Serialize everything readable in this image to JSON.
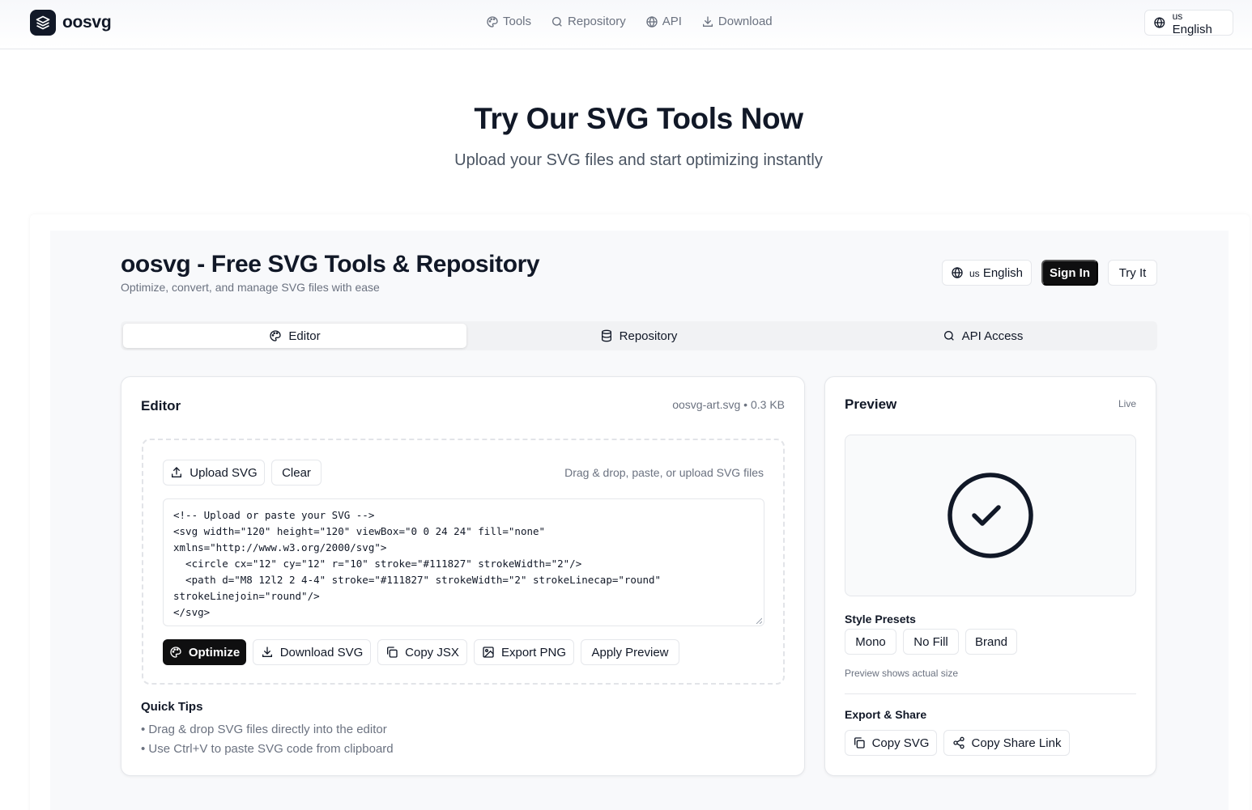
{
  "nav": {
    "brand": "oosvg",
    "links": [
      "Tools",
      "Repository",
      "API",
      "Download"
    ],
    "lang_code": "us",
    "lang_label": "English"
  },
  "hero": {
    "title": "Try Our SVG Tools Now",
    "subtitle": "Upload your SVG files and start optimizing instantly"
  },
  "app": {
    "title": "oosvg - Free SVG Tools & Repository",
    "subtitle": "Optimize, convert, and manage SVG files with ease",
    "lang_code": "us",
    "lang_label": "English",
    "sign_in": "Sign In",
    "try_it": "Try It"
  },
  "tabs": [
    "Editor",
    "Repository",
    "API Access"
  ],
  "editor": {
    "title": "Editor",
    "file_name": "oosvg-art.svg",
    "file_size": "0.3 KB",
    "upload_label": "Upload SVG",
    "clear_label": "Clear",
    "hint": "Drag & drop, paste, or upload SVG files",
    "code": "<!-- Upload or paste your SVG -->\n<svg width=\"120\" height=\"120\" viewBox=\"0 0 24 24\" fill=\"none\"\nxmlns=\"http://www.w3.org/2000/svg\">\n  <circle cx=\"12\" cy=\"12\" r=\"10\" stroke=\"#111827\" strokeWidth=\"2\"/>\n  <path d=\"M8 12l2 2 4-4\" stroke=\"#111827\" strokeWidth=\"2\" strokeLinecap=\"round\"\nstrokeLinejoin=\"round\"/>\n</svg>",
    "actions": [
      "Optimize",
      "Download SVG",
      "Copy JSX",
      "Export PNG",
      "Apply Preview"
    ],
    "tips_title": "Quick Tips",
    "tips": [
      "• Drag & drop SVG files directly into the editor",
      "• Use Ctrl+V to paste SVG code from clipboard"
    ]
  },
  "preview": {
    "title": "Preview",
    "status": "Live",
    "icon": "check-circle-icon",
    "presets_title": "Style Presets",
    "presets": [
      "Mono",
      "No Fill",
      "Brand"
    ],
    "note": "Preview shows actual size",
    "export_title": "Export & Share",
    "copy_svg": "Copy SVG",
    "copy_link": "Copy Share Link"
  },
  "colors": {
    "primary": "#0f0f10",
    "text": "#111827",
    "muted": "#6b7280",
    "border": "#e5e7eb"
  }
}
